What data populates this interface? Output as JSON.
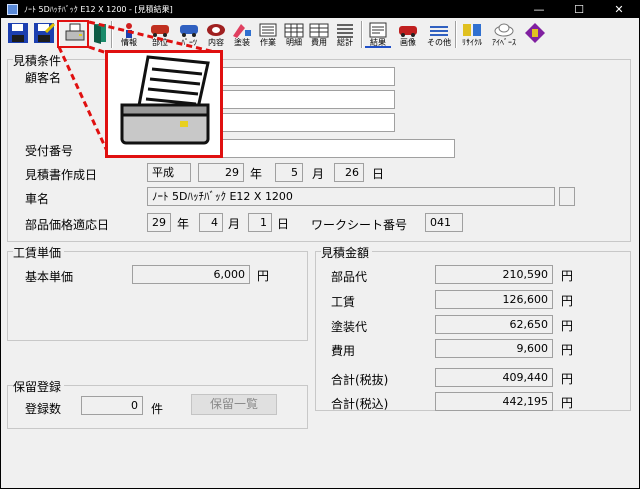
{
  "window": {
    "title": "ﾉｰﾄ 5Dﾊｯﾁﾊﾞｯｸ E12 X     1200 - [見積結果]",
    "minimize": "—",
    "maximize": "☐",
    "close": "✕"
  },
  "toolbar": {
    "items": [
      {
        "label": "",
        "icon": "save-icon"
      },
      {
        "label": "",
        "icon": "save-as-icon"
      },
      {
        "label": "",
        "icon": "printer-icon"
      },
      {
        "label": "",
        "icon": "exit-door-icon"
      },
      {
        "label": "情報",
        "icon": "info-icon"
      },
      {
        "label": "部位",
        "icon": "part-icon"
      },
      {
        "label": "ﾊﾟｰﾂ",
        "icon": "parts-icon"
      },
      {
        "label": "内容",
        "icon": "content-icon"
      },
      {
        "label": "塗装",
        "icon": "paint-icon"
      },
      {
        "label": "作業",
        "icon": "work-icon"
      },
      {
        "label": "明細",
        "icon": "detail-icon"
      },
      {
        "label": "費用",
        "icon": "cost-icon"
      },
      {
        "label": "総計",
        "icon": "total-icon"
      },
      {
        "label": "結果",
        "icon": "result-icon"
      },
      {
        "label": "画像",
        "icon": "image-icon"
      },
      {
        "label": "その他",
        "icon": "other-icon"
      },
      {
        "label": "ﾘｻｲｸﾙ",
        "icon": "recycle-icon"
      },
      {
        "label": "ｱｲﾍﾞｰｽ",
        "icon": "cloud-icon"
      },
      {
        "label": "",
        "icon": "help-book-icon"
      }
    ]
  },
  "estimate_conditions": {
    "section_title": "見積条件",
    "customer_name_label": "顧客名",
    "reception_number_label": "受付番号",
    "created_date_label": "見積書作成日",
    "era": "平成",
    "year": "29",
    "year_unit": "年",
    "month": "5",
    "month_unit": "月",
    "day": "26",
    "day_unit": "日",
    "vehicle_label": "車名",
    "vehicle_value": "ﾉｰﾄ 5Dﾊｯﾁﾊﾞｯｸ E12 X         1200",
    "price_date_label": "部品価格適応日",
    "price_year": "29",
    "price_month": "4",
    "price_day": "1",
    "worksheet_label": "ワークシート番号",
    "worksheet_value": "041"
  },
  "labor_rate": {
    "section_title": "工賃単価",
    "basic_rate_label": "基本単価",
    "basic_rate_value": "6,000",
    "yen": "円"
  },
  "estimate_amount": {
    "section_title": "見積金額",
    "rows": [
      {
        "label": "部品代",
        "value": "210,590",
        "unit": "円"
      },
      {
        "label": "工賃",
        "value": "126,600",
        "unit": "円"
      },
      {
        "label": "塗装代",
        "value": "62,650",
        "unit": "円"
      },
      {
        "label": "費用",
        "value": "9,600",
        "unit": "円"
      },
      {
        "label": "合計(税抜)",
        "value": "409,440",
        "unit": "円"
      },
      {
        "label": "合計(税込)",
        "value": "442,195",
        "unit": "円"
      }
    ]
  },
  "hold_registration": {
    "section_title": "保留登録",
    "count_label": "登録数",
    "count_value": "0",
    "count_unit": "件",
    "list_button": "保留一覧"
  },
  "colors": {
    "highlight": "#e01010",
    "titlebar": "#000000",
    "background": "#f0f0f0"
  }
}
